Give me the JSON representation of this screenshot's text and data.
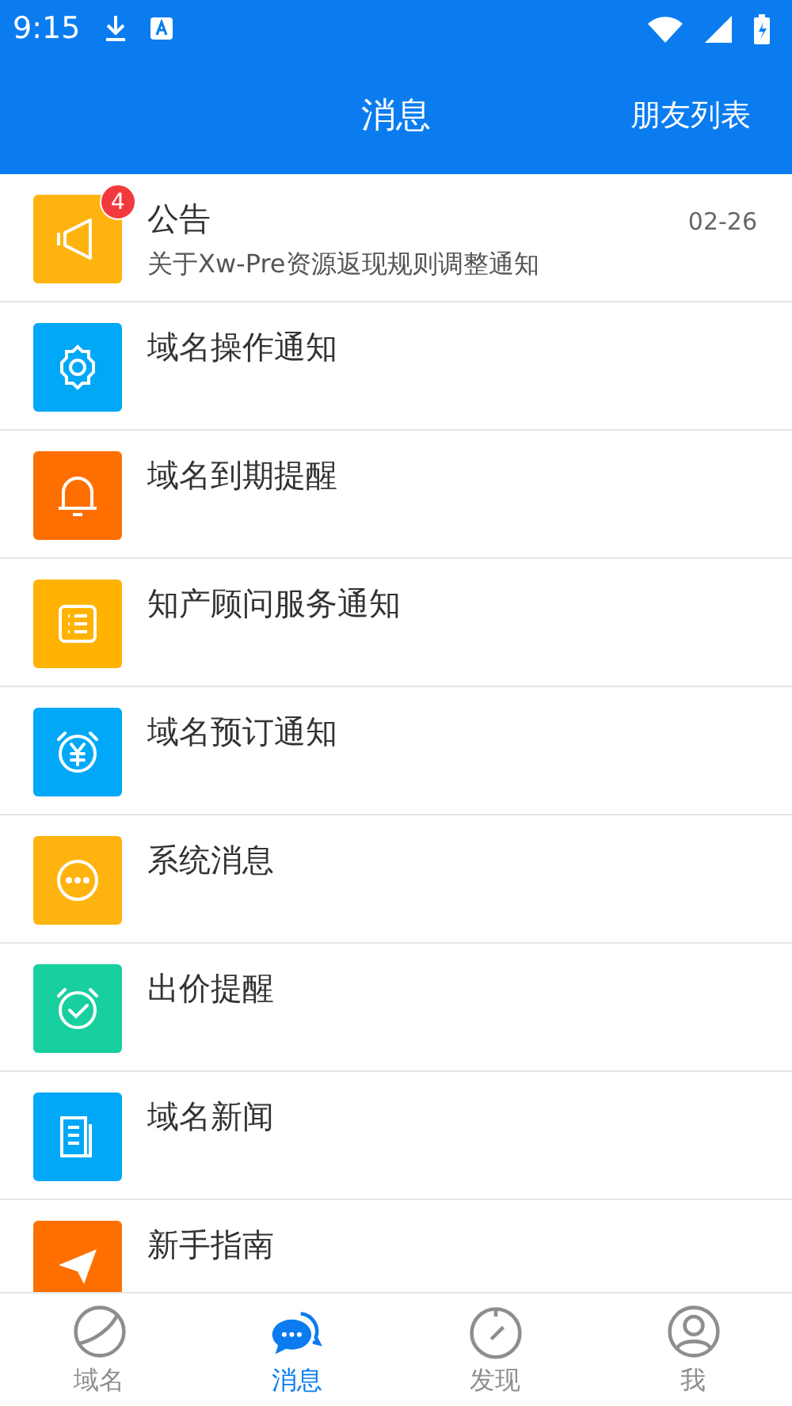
{
  "status_bar": {
    "time": "9:15"
  },
  "header": {
    "title": "消息",
    "action": "朋友列表"
  },
  "messages": [
    {
      "kind": "megaphone",
      "color": "#ffb30f",
      "title": "公告",
      "subtitle": "关于Xw-Pre资源返现规则调整通知",
      "date": "02-26",
      "badge": "4"
    },
    {
      "kind": "gear",
      "color": "#00a8f7",
      "title": "域名操作通知"
    },
    {
      "kind": "bell",
      "color": "#ff6f00",
      "title": "域名到期提醒"
    },
    {
      "kind": "list",
      "color": "#ffb300",
      "title": "知产顾问服务通知"
    },
    {
      "kind": "yen-clock",
      "color": "#00a8f7",
      "title": "域名预订通知"
    },
    {
      "kind": "dots",
      "color": "#ffb30f",
      "title": "系统消息"
    },
    {
      "kind": "check-clock",
      "color": "#17cf9f",
      "title": "出价提醒"
    },
    {
      "kind": "news",
      "color": "#00a8f7",
      "title": "域名新闻"
    },
    {
      "kind": "plane",
      "color": "#ff6f00",
      "title": "新手指南"
    }
  ],
  "nav": [
    {
      "kind": "globe",
      "label": "域名",
      "selected": false
    },
    {
      "kind": "chat",
      "label": "消息",
      "selected": true
    },
    {
      "kind": "compass",
      "label": "发现",
      "selected": false
    },
    {
      "kind": "person",
      "label": "我",
      "selected": false
    }
  ]
}
